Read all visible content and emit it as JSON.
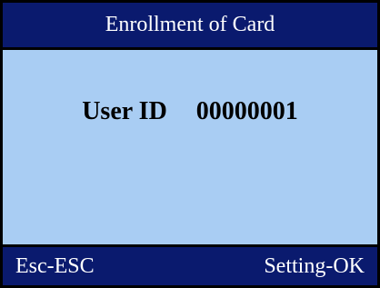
{
  "title": "Enrollment of Card",
  "user": {
    "label": "User ID",
    "value": "00000001"
  },
  "footer": {
    "left": "Esc-ESC",
    "right": "Setting-OK"
  },
  "colors": {
    "header_bg": "#0a1a6e",
    "content_bg": "#a9cdf3",
    "text_light": "#ffffff",
    "text_dark": "#000000"
  }
}
